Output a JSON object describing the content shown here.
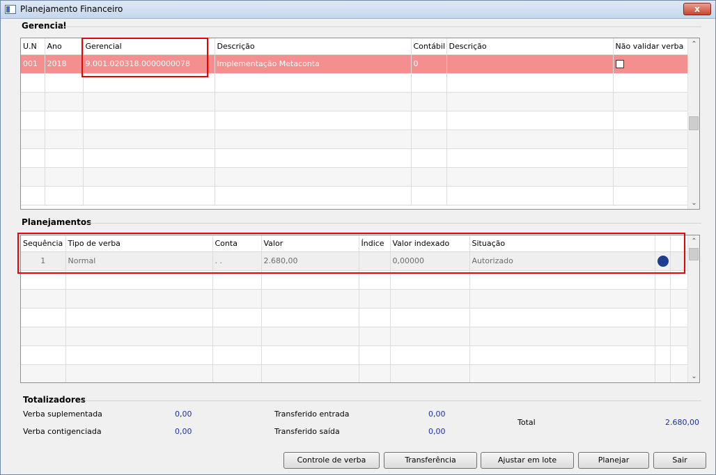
{
  "window": {
    "title": "Planejamento Financeiro",
    "close_label": "x"
  },
  "gerencial": {
    "label": "Gerencial",
    "columns": [
      "U.N",
      "Ano",
      "Gerencial",
      "Descrição",
      "Contábil",
      "Descrição",
      "Não validar verba"
    ],
    "rows": [
      {
        "un": "001",
        "ano": "2018",
        "gerencial": "9.001.020318.0000000078",
        "descricao": "Implementação Metaconta",
        "contabil": "0",
        "descricao2": "",
        "nao_validar": false
      }
    ]
  },
  "planejamentos": {
    "label": "Planejamentos",
    "columns": [
      "Sequência",
      "Tipo de verba",
      "Conta",
      "Valor",
      "Índice",
      "Valor indexado",
      "Situação"
    ],
    "rows": [
      {
        "sequencia": "1",
        "tipo": "Normal",
        "conta": ". .",
        "valor": "2.680,00",
        "indice": "",
        "valor_indexado": "0,00000",
        "situacao": "Autorizado",
        "status_color": "#1f3d8f"
      }
    ]
  },
  "totalizadores": {
    "label": "Totalizadores",
    "verba_suplementada_label": "Verba suplementada",
    "verba_suplementada_value": "0,00",
    "verba_contigenciada_label": "Verba contigenciada",
    "verba_contigenciada_value": "0,00",
    "transferido_entrada_label": "Transferido entrada",
    "transferido_entrada_value": "0,00",
    "transferido_saida_label": "Transferido saída",
    "transferido_saida_value": "0,00",
    "total_label": "Total",
    "total_value": "2.680,00"
  },
  "buttons": {
    "controle": "Controle de verba",
    "transferencia": "Transferência",
    "ajustar": "Ajustar em lote",
    "planejar": "Planejar",
    "sair": "Sair"
  },
  "colors": {
    "selected_row": "#f58f8f",
    "highlight_border": "#ee0000",
    "value_text": "#1c2fb0"
  }
}
